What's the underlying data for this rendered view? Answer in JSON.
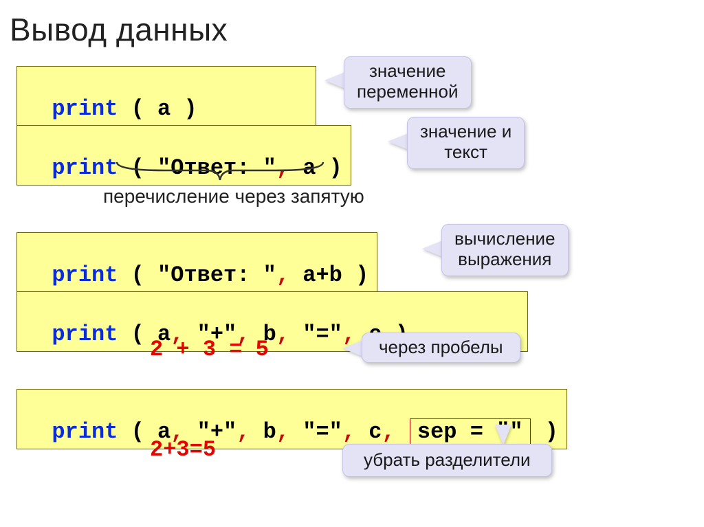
{
  "title": "Вывод данных",
  "code1": {
    "kw": "print",
    "rest": " ( a )"
  },
  "callout1": "значение\nпеременной",
  "code2": {
    "kw": "print",
    "p1": " ( ",
    "str": "\"Ответ: \"",
    "cm": ",",
    "p2": " a )"
  },
  "callout2": "значение и\nтекст",
  "note1": "перечисление через запятую",
  "code3": {
    "kw": "print",
    "p1": " ( ",
    "str": "\"Ответ: \"",
    "cm": ",",
    "p2": " a+b )"
  },
  "callout3": "вычисление\nвыражения",
  "code4": {
    "kw": "print",
    "p1": " ( a",
    "c1": ",",
    "s1": " \"+\"",
    "c2": ",",
    "s2": " b",
    "c3": ",",
    "s3": " \"=\"",
    "c4": ",",
    "s4": " c )"
  },
  "output1": "2 + 3 = 5",
  "callout4": "через пробелы",
  "code5": {
    "kw": "print",
    "p1": " ( a",
    "c1": ",",
    "s1": " \"+\"",
    "c2": ",",
    "s2": " b",
    "c3": ",",
    "s3": " \"=\"",
    "c4": ",",
    "s4": " c",
    "c5": ",",
    "sep": "sep = \"\"",
    "end": " )"
  },
  "output2": "2+3=5",
  "callout5": "убрать разделители"
}
